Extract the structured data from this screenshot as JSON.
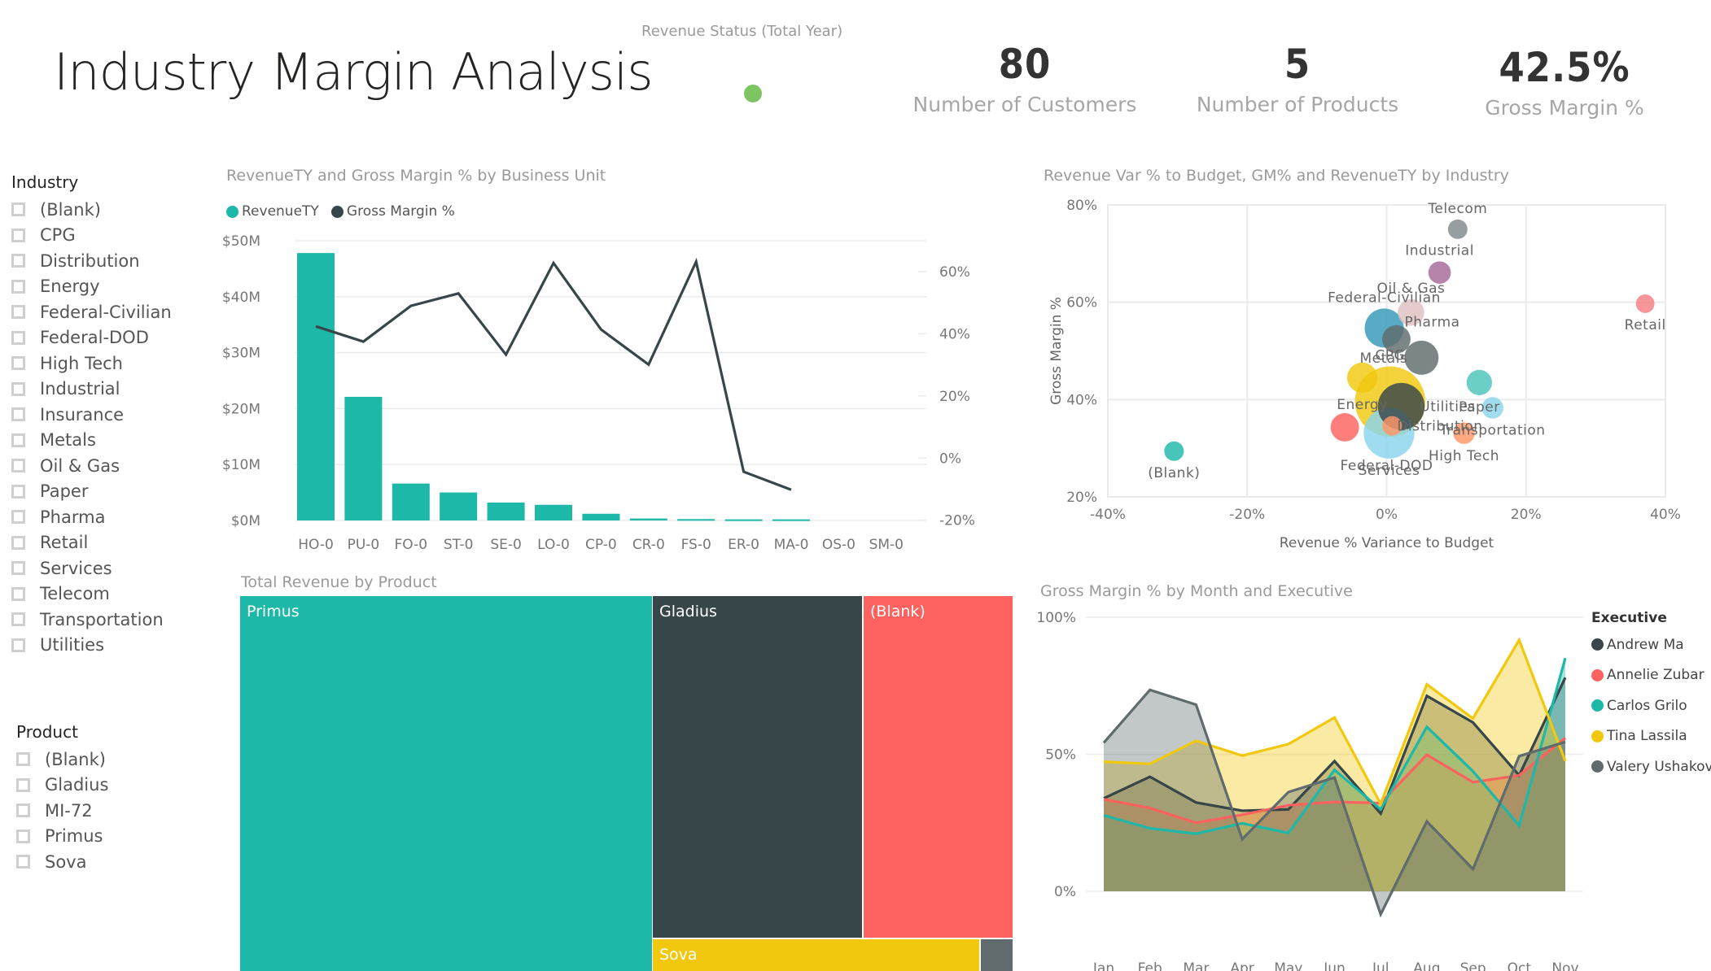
{
  "header": {
    "title": "Industry Margin Analysis",
    "revenue_status_label": "Revenue Status (Total Year)",
    "revenue_status_color": "#7DC462"
  },
  "kpis": [
    {
      "value": "80",
      "label": "Number of Customers"
    },
    {
      "value": "5",
      "label": "Number of Products"
    },
    {
      "value": "42.5%",
      "label": "Gross Margin %"
    }
  ],
  "industry_slicer": {
    "title": "Industry",
    "items": [
      "(Blank)",
      "CPG",
      "Distribution",
      "Energy",
      "Federal-Civilian",
      "Federal-DOD",
      "High Tech",
      "Industrial",
      "Insurance",
      "Metals",
      "Oil & Gas",
      "Paper",
      "Pharma",
      "Retail",
      "Services",
      "Telecom",
      "Transportation",
      "Utilities"
    ]
  },
  "product_slicer": {
    "title": "Product",
    "items": [
      "(Blank)",
      "Gladius",
      "MI-72",
      "Primus",
      "Sova"
    ]
  },
  "colors": {
    "teal": "#1DB8A8",
    "dark": "#374649",
    "red": "#FD625E",
    "yellow": "#F2C80F",
    "gray": "#5F6B6D",
    "light_blue": "#8AD4EB",
    "orange": "#FE9666",
    "purple": "#A66999",
    "blue": "#3599B8",
    "pink": "#DFBFBF",
    "aqua": "#4AC5BB",
    "slate": "#5F6B6D"
  },
  "chart_data": [
    {
      "id": "combo",
      "type": "bar",
      "title": "RevenueTY and Gross Margin % by Business Unit",
      "categories": [
        "HO-0",
        "PU-0",
        "FO-0",
        "ST-0",
        "SE-0",
        "LO-0",
        "CP-0",
        "CR-0",
        "FS-0",
        "ER-0",
        "MA-0",
        "OS-0",
        "SM-0"
      ],
      "series": [
        {
          "name": "RevenueTY",
          "type": "bar",
          "axis": "left",
          "color": "#1DB8A8",
          "values": [
            47.8,
            22.1,
            6.6,
            5.0,
            3.2,
            2.8,
            1.2,
            0.35,
            0.25,
            0.2,
            0.2,
            0,
            0
          ]
        },
        {
          "name": "Gross Margin %",
          "type": "line",
          "axis": "right",
          "color": "#374649",
          "values": [
            42.4,
            37.5,
            49.0,
            53.0,
            33.3,
            62.8,
            41.4,
            30.1,
            63.2,
            -4.4,
            -10.2,
            null,
            null
          ]
        }
      ],
      "y_left": {
        "ticks": [
          "$0M",
          "$10M",
          "$20M",
          "$30M",
          "$40M",
          "$50M"
        ],
        "range": [
          0,
          50
        ],
        "unit": "$M"
      },
      "y_right": {
        "ticks": [
          "-20%",
          "0%",
          "20%",
          "40%",
          "60%"
        ],
        "range": [
          -20,
          70
        ]
      },
      "legend": "top-left",
      "grid": true
    },
    {
      "id": "scatter",
      "type": "scatter",
      "title": "Revenue Var % to Budget, GM% and RevenueTY by Industry",
      "xlabel": "Revenue % Variance to Budget",
      "ylabel": "Gross Margin %",
      "xlim": [
        -40,
        40
      ],
      "ylim": [
        20,
        80
      ],
      "x_ticks": [
        "-40%",
        "-20%",
        "0%",
        "20%",
        "40%"
      ],
      "y_ticks": [
        "20%",
        "40%",
        "60%",
        "80%"
      ],
      "grid": true,
      "points": [
        {
          "label": "(Blank)",
          "x": -30.5,
          "y": 29.4,
          "size": 1.0,
          "color": "#1DB8A8",
          "label_pos": "below"
        },
        {
          "label": "Telecom",
          "x": 10.2,
          "y": 75.0,
          "size": 1.0,
          "color": "#7F898A",
          "label_pos": "above"
        },
        {
          "label": "Industrial",
          "x": 7.6,
          "y": 66.1,
          "size": 1.15,
          "color": "#A66999",
          "label_pos": "above"
        },
        {
          "label": "Retail",
          "x": 37.1,
          "y": 59.7,
          "size": 0.95,
          "color": "#F47F81",
          "label_pos": "below"
        },
        {
          "label": "Oil & Gas",
          "x": 3.5,
          "y": 57.9,
          "size": 1.35,
          "color": "#DFBFBF",
          "label_pos": "above"
        },
        {
          "label": "Federal-Civilian",
          "x": -0.35,
          "y": 54.7,
          "size": 2.0,
          "color": "#3599B8",
          "label_pos": "above"
        },
        {
          "label": "Pharma",
          "x": 1.4,
          "y": 52.4,
          "size": 1.45,
          "color": "#5F6B6D",
          "label_pos": "above-right"
        },
        {
          "label": "Metals",
          "x": 5.0,
          "y": 48.6,
          "size": 1.75,
          "color": "#5F6B6D",
          "label_pos": "left"
        },
        {
          "label": "Energy",
          "x": -3.5,
          "y": 44.5,
          "size": 1.55,
          "color": "#F2C80F",
          "label_pos": "below"
        },
        {
          "label": "CPG",
          "x": 0.5,
          "y": 39.6,
          "size": 3.6,
          "color": "#F2C80F",
          "label_pos": "above"
        },
        {
          "label": "Utilities",
          "x": 2.1,
          "y": 38.6,
          "size": 2.4,
          "color": "#374649",
          "label_pos": "right"
        },
        {
          "label": "Paper",
          "x": 13.3,
          "y": 43.5,
          "size": 1.3,
          "color": "#4AC5BB",
          "label_pos": "below"
        },
        {
          "label": "Transportation",
          "x": 15.2,
          "y": 38.3,
          "size": 1.1,
          "color": "#8AD4EB",
          "label_pos": "below"
        },
        {
          "label": "",
          "x": -6.0,
          "y": 34.3,
          "size": 1.45,
          "color": "#FD625E",
          "label_pos": "none"
        },
        {
          "label": "Services",
          "x": 0.35,
          "y": 33.1,
          "size": 2.6,
          "color": "#8AD4EB",
          "label_pos": "below"
        },
        {
          "label": "Distribution",
          "x": 0.8,
          "y": 34.6,
          "size": 1.0,
          "color": "#FE9666",
          "label_pos": "right"
        },
        {
          "label": "High Tech",
          "x": 11.1,
          "y": 33.1,
          "size": 1.1,
          "color": "#FE9666",
          "label_pos": "below"
        },
        {
          "label": "Federal-DOD",
          "x": 0.0,
          "y": 26.5,
          "size": 0,
          "color": "#8AD4EB",
          "label_pos": "text-only"
        }
      ]
    },
    {
      "id": "treemap",
      "type": "treemap",
      "title": "Total Revenue by Product",
      "tiles": [
        {
          "label": "Primus",
          "color": "#1DB8A8"
        },
        {
          "label": "Gladius",
          "color": "#374649"
        },
        {
          "label": "(Blank)",
          "color": "#FD625E"
        },
        {
          "label": "Sova",
          "color": "#F2C80F"
        },
        {
          "label": "",
          "color": "#5F6B6D"
        }
      ]
    },
    {
      "id": "area",
      "type": "area",
      "title": "Gross Margin % by Month and Executive",
      "categories": [
        "Jan",
        "Feb",
        "Mar",
        "Apr",
        "May",
        "Jun",
        "Jul",
        "Aug",
        "Sep",
        "Oct",
        "Nov"
      ],
      "y_ticks": [
        "0%",
        "50%",
        "100%"
      ],
      "ylim": [
        -15,
        100
      ],
      "legend_title": "Executive",
      "legend": "right",
      "series": [
        {
          "name": "Andrew Ma",
          "color": "#374649",
          "values": [
            33.9,
            41.8,
            32.4,
            29.4,
            29.9,
            47.5,
            28.4,
            71.3,
            61.6,
            42.3,
            78.0
          ]
        },
        {
          "name": "Annelie Zubar",
          "color": "#FD625E",
          "values": [
            33.6,
            30.4,
            25.0,
            27.9,
            31.4,
            32.6,
            32.2,
            49.8,
            39.8,
            42.3,
            56.0
          ]
        },
        {
          "name": "Carlos Grilo",
          "color": "#1DB8A8",
          "values": [
            27.7,
            23.0,
            21.0,
            24.8,
            21.3,
            44.3,
            29.9,
            60.0,
            43.8,
            24.0,
            85.1
          ]
        },
        {
          "name": "Tina Lassila",
          "color": "#F2C80F",
          "values": [
            47.3,
            46.5,
            54.9,
            49.5,
            53.7,
            63.4,
            31.9,
            75.5,
            63.1,
            91.7,
            47.5
          ]
        },
        {
          "name": "Valery Ushakov",
          "color": "#5F6B6D",
          "values": [
            54.2,
            73.5,
            68.1,
            19.0,
            36.2,
            41.5,
            -8.4,
            25.5,
            8.1,
            49.3,
            54.5
          ]
        }
      ]
    }
  ]
}
